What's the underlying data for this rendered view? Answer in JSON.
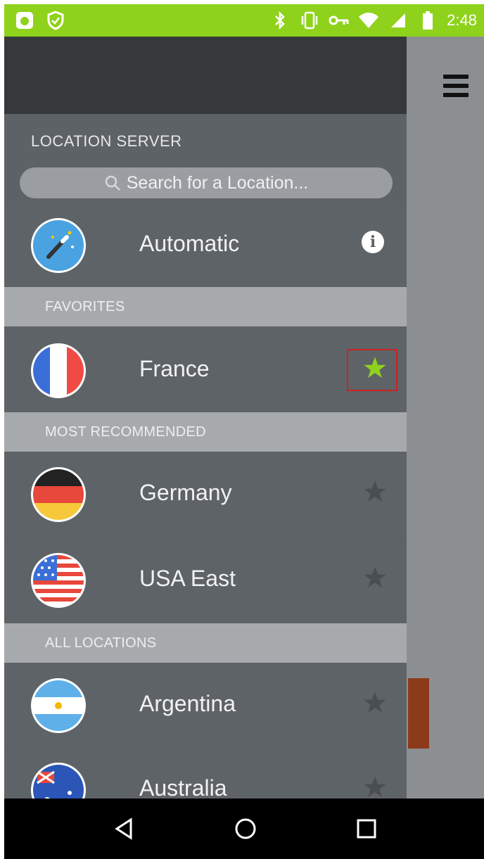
{
  "status_bar": {
    "time": "2:48",
    "left_icons": [
      "app-icon",
      "shield-icon"
    ],
    "right_icons": [
      "bluetooth-icon",
      "vibrate-icon",
      "vpn-key-icon",
      "wifi-icon",
      "signal-icon",
      "battery-icon"
    ],
    "color": "#8fd21c"
  },
  "drawer": {
    "section_title": "LOCATION SERVER",
    "search": {
      "placeholder": "Search for a Location..."
    },
    "automatic": {
      "label": "Automatic",
      "info_icon": "info-icon"
    },
    "groups": [
      {
        "header": "FAVORITES",
        "items": [
          {
            "label": "France",
            "favorite": true
          }
        ]
      },
      {
        "header": "MOST RECOMMENDED",
        "items": [
          {
            "label": "Germany",
            "favorite": false
          },
          {
            "label": "USA East",
            "favorite": false
          }
        ]
      },
      {
        "header": "ALL LOCATIONS",
        "items": [
          {
            "label": "Argentina",
            "favorite": false
          },
          {
            "label": "Australia",
            "favorite": false
          }
        ]
      }
    ]
  },
  "colors": {
    "favorite_star": "#8fd21c",
    "star_inactive": "#4a4e52",
    "highlight_box": "#cc2222"
  },
  "nav": {
    "buttons": [
      "back-icon",
      "home-icon",
      "recents-icon"
    ]
  }
}
